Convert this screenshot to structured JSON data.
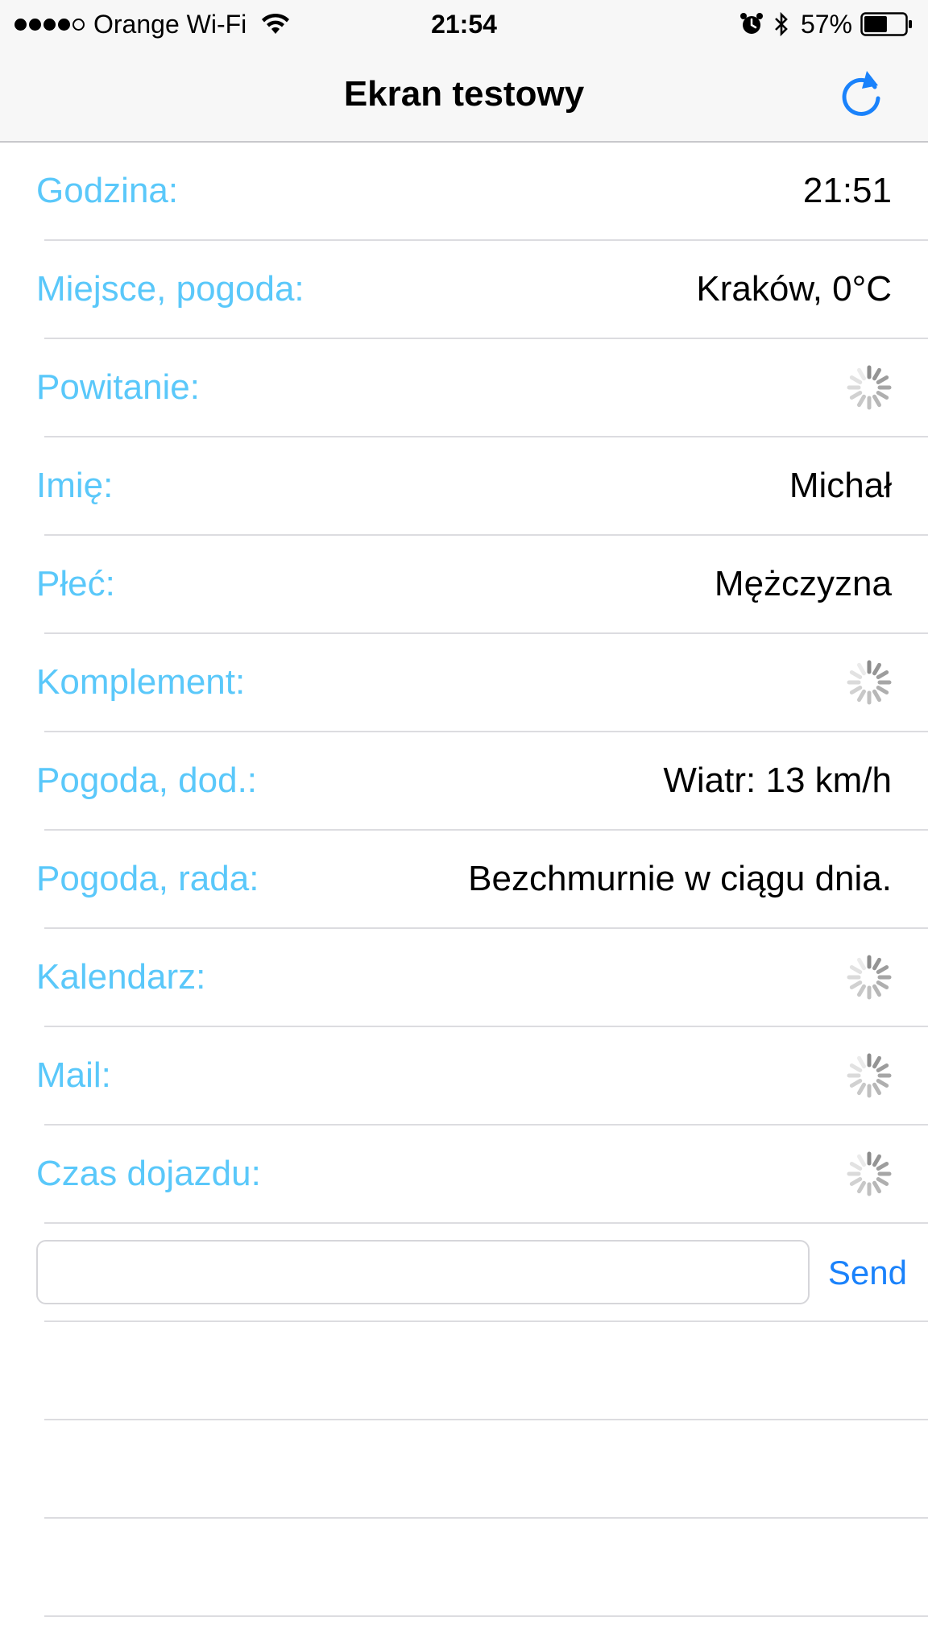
{
  "status_bar": {
    "carrier": "Orange Wi-Fi",
    "signal_bars_filled": 4,
    "signal_bars_total": 5,
    "time": "21:54",
    "battery_percent": "57%",
    "battery_level": 0.57,
    "icons": [
      "wifi-icon",
      "alarm-icon",
      "bluetooth-icon",
      "battery-icon"
    ]
  },
  "nav": {
    "title": "Ekran testowy",
    "right_icon": "refresh-icon",
    "accent_color": "#1a82fb"
  },
  "rows": [
    {
      "label": "Godzina:",
      "value": "21:51",
      "loading": false
    },
    {
      "label": "Miejsce, pogoda:",
      "value": "Kraków, 0°C",
      "loading": false
    },
    {
      "label": "Powitanie:",
      "value": "",
      "loading": true
    },
    {
      "label": "Imię:",
      "value": "Michał",
      "loading": false
    },
    {
      "label": "Płeć:",
      "value": "Mężczyzna",
      "loading": false
    },
    {
      "label": "Komplement:",
      "value": "",
      "loading": true
    },
    {
      "label": "Pogoda, dod.:",
      "value": "Wiatr: 13 km/h",
      "loading": false
    },
    {
      "label": "Pogoda, rada:",
      "value": "Bezchmurnie w ciągu dnia.",
      "loading": false
    },
    {
      "label": "Kalendarz:",
      "value": "",
      "loading": true
    },
    {
      "label": "Mail:",
      "value": "",
      "loading": true
    },
    {
      "label": "Czas dojazdu:",
      "value": "",
      "loading": true
    }
  ],
  "send_form": {
    "input_value": "",
    "placeholder": "",
    "button_label": "Send"
  },
  "colors": {
    "label": "#5ac8fa",
    "value": "#000000",
    "separator": "#dcdce0",
    "bar_background": "#f7f7f7"
  }
}
